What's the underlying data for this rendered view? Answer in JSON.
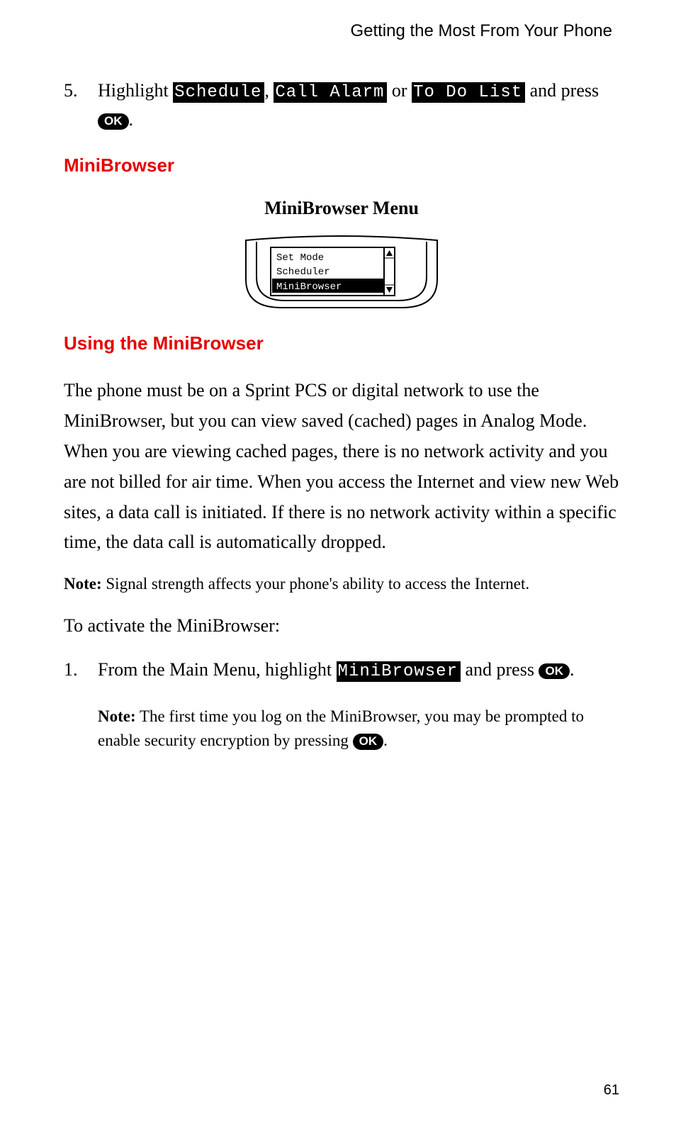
{
  "header": "Getting the Most From Your Phone",
  "step5": {
    "num": "5.",
    "t1": "Highlight ",
    "mono1": "Schedule",
    "t2": ", ",
    "mono2": "Call Alarm",
    "t3": " or ",
    "mono3": "To Do List",
    "t4": " and press ",
    "ok": "OK",
    "t5": "."
  },
  "heading1": "MiniBrowser",
  "heading2": "MiniBrowser Menu",
  "diagram": {
    "item1": "Set Mode",
    "item2": "Scheduler",
    "item3": "MiniBrowser"
  },
  "heading3": "Using the MiniBrowser",
  "para1": "The phone must be on a Sprint PCS or digital network to use the MiniBrowser, but you can view saved (cached) pages in Analog Mode. When you are viewing cached pages, there is no network activity and you are not billed for air time. When you access the Internet and view new Web sites, a data call is initiated. If there is no network activity within a specific time, the data call is automatically dropped.",
  "note1": {
    "label": "Note:",
    "text": " Signal strength affects your phone's ability to access the  Internet."
  },
  "para2": "To activate the MiniBrowser:",
  "step1": {
    "num": "1.",
    "t1": "From the Main Menu, highlight ",
    "mono1": "MiniBrowser",
    "t2": " and press ",
    "ok": "OK",
    "t3": "."
  },
  "note2": {
    "label": "Note:",
    "t1": " The first time you log on the MiniBrowser, you may be prompted to enable security encryption by pressing ",
    "ok": "OK",
    "t2": "."
  },
  "pageNumber": "61"
}
